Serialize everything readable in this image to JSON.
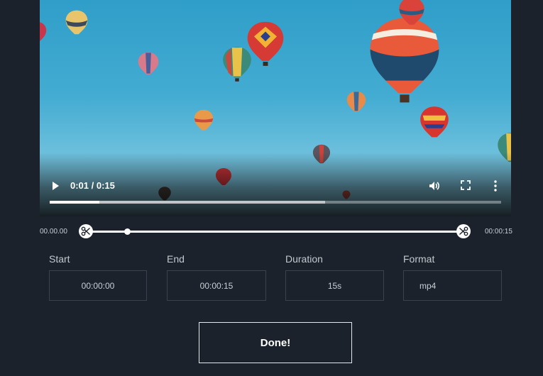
{
  "player": {
    "time_display": "0:01 / 0:15",
    "progress_fraction": 0.11,
    "buffered_fraction": 0.61,
    "icons": [
      "play-icon",
      "volume-icon",
      "fullscreen-icon",
      "more-vertical-icon"
    ]
  },
  "trim": {
    "start_time": "00.00.00",
    "end_time": "00:00:15",
    "playhead_fraction": 0.11,
    "icons": [
      "scissors-icon"
    ]
  },
  "fields": {
    "start": {
      "label": "Start",
      "value": "00:00:00"
    },
    "end": {
      "label": "End",
      "value": "00:00:15"
    },
    "duration": {
      "label": "Duration",
      "value": "15s"
    },
    "format": {
      "label": "Format",
      "value": "mp4"
    }
  },
  "done_label": "Done!",
  "colors": {
    "background": "#1c222b",
    "field_border": "#3a424e",
    "sky": "#44acd2"
  }
}
